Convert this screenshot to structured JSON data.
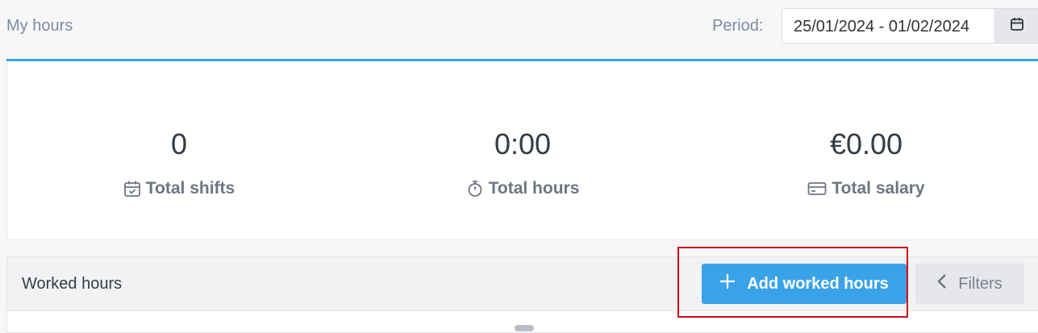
{
  "header": {
    "title": "My hours",
    "period_label": "Period:",
    "period_value": "25/01/2024 - 01/02/2024",
    "calendar_icon": "calendar-icon"
  },
  "stats": [
    {
      "value": "0",
      "label": "Total shifts",
      "icon": "calendar-check-icon"
    },
    {
      "value": "0:00",
      "label": "Total hours",
      "icon": "stopwatch-icon"
    },
    {
      "value": "€0.00",
      "label": "Total salary",
      "icon": "credit-card-icon"
    }
  ],
  "worked_hours": {
    "title": "Worked hours",
    "add_button_label": "Add worked hours",
    "add_icon": "plus-icon",
    "filters_label": "Filters",
    "filters_icon": "chevron-left-icon"
  },
  "colors": {
    "accent": "#3aa3e8",
    "highlight": "#d0021b"
  }
}
